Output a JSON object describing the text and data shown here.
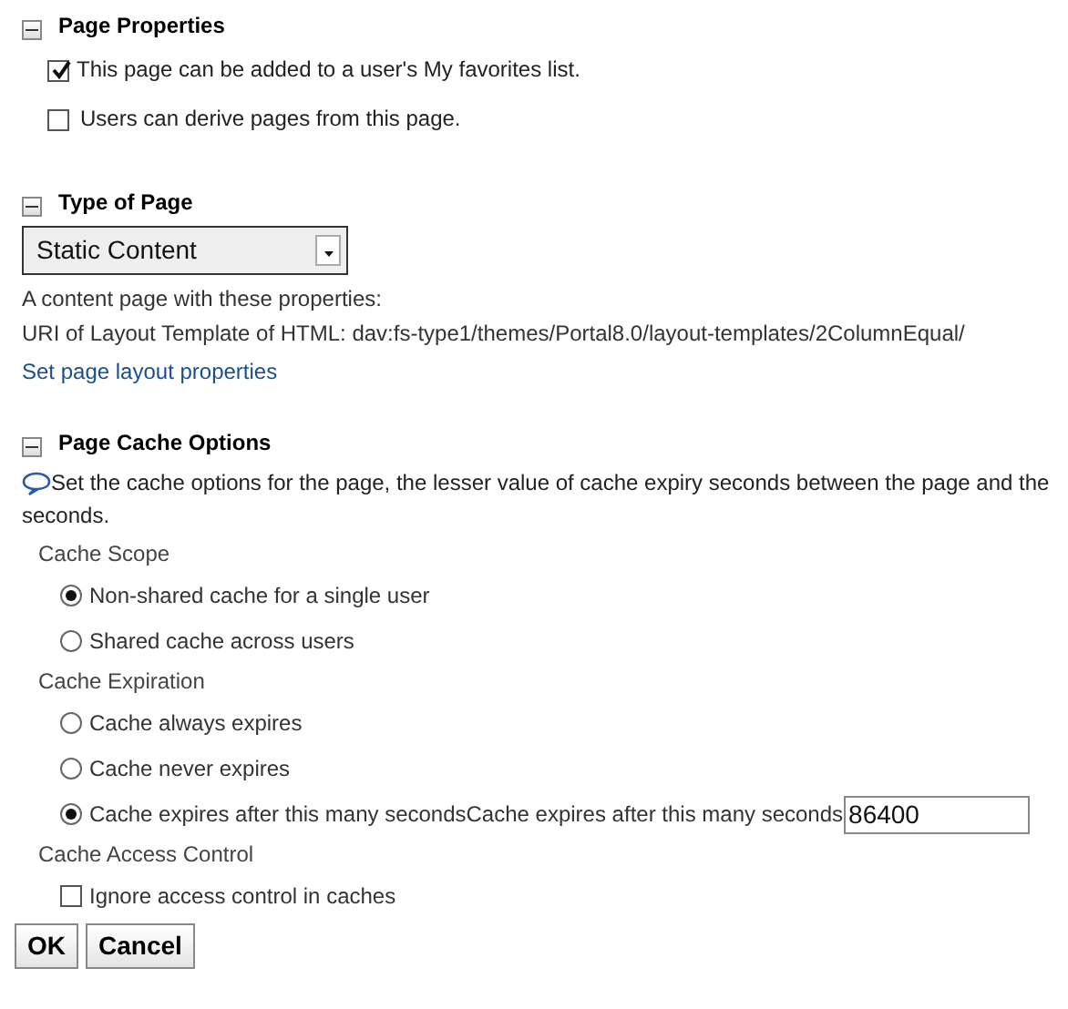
{
  "page_properties": {
    "title": "Page Properties",
    "expanded": true,
    "options": [
      {
        "label": "This page can be added to a user's My favorites list.",
        "checked": true
      },
      {
        "label": "Users can derive pages from this page.",
        "checked": false
      }
    ]
  },
  "type_of_page": {
    "title": "Type of Page",
    "expanded": true,
    "select_value": "Static Content",
    "description": "A content page with these properties:",
    "uri": "URI of Layout Template of HTML: dav:fs-type1/themes/Portal8.0/layout-templates/2ColumnEqual/",
    "link": "Set page layout properties"
  },
  "page_cache_options": {
    "title": "Page Cache Options",
    "expanded": true,
    "description_lines": [
      "Set the cache options for the page, the lesser value of cache expiry seconds between the page and the",
      "seconds."
    ],
    "groups": [
      {
        "label": "Cache Scope",
        "kind": "radio",
        "options": [
          {
            "label": "Non-shared cache for a single user",
            "selected": true
          },
          {
            "label": "Shared cache across users",
            "selected": false
          }
        ]
      },
      {
        "label": "Cache Expiration",
        "kind": "radio",
        "options": [
          {
            "label": "Cache always expires",
            "selected": false
          },
          {
            "label": "Cache never expires",
            "selected": false
          },
          {
            "label": "Cache expires after this many secondsCache expires after this many seconds",
            "selected": true,
            "value": "86400"
          }
        ]
      },
      {
        "label": "Cache Access Control",
        "kind": "checkbox",
        "options": [
          {
            "label": "Ignore access control in caches",
            "checked": false
          }
        ]
      }
    ]
  },
  "buttons": [
    "OK",
    "Cancel"
  ]
}
